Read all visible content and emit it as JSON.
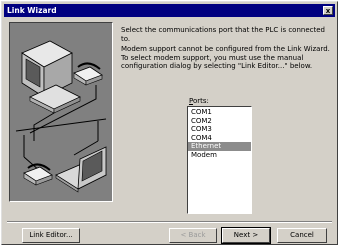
{
  "window": {
    "title": "Link Wizard",
    "close_glyph": "x"
  },
  "illustration": {
    "icons": [
      "desktop-computer-icon",
      "telephone-modem-icon",
      "network-cable-icon",
      "laptop-computer-icon"
    ]
  },
  "message": {
    "line1": "Select the communications port that the PLC is connected to.",
    "line2": "Modem support cannot be configured from the Link Wizard. To select modem support, you must use the manual configuration dialog by selecting \"Link Editor...\" below."
  },
  "ports": {
    "label_underlined": "P",
    "label_rest": "orts:",
    "items": [
      {
        "label": "COM1"
      },
      {
        "label": "COM2"
      },
      {
        "label": "COM3"
      },
      {
        "label": "COM4"
      },
      {
        "label": "Ethernet"
      },
      {
        "label": "Modem"
      }
    ],
    "selected": "Ethernet"
  },
  "buttons": {
    "link_editor": "Link Editor...",
    "back": "< Back",
    "next": "Next >",
    "cancel": "Cancel"
  }
}
